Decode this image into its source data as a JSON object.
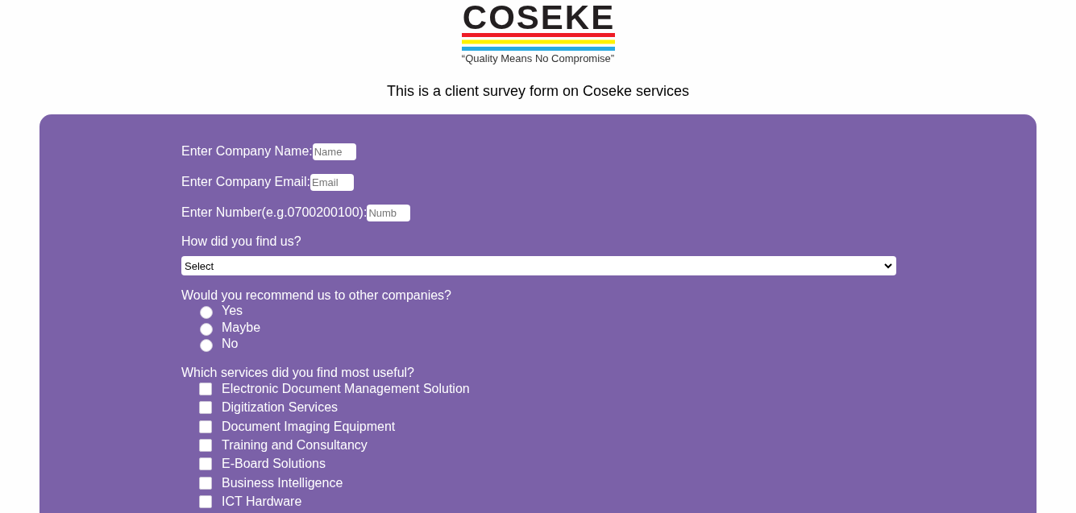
{
  "logo": {
    "wordmark": "COSEKE",
    "tagline": "“Quality Means No Compromise”"
  },
  "intro": "This is a client survey form on Coseke services",
  "fields": [
    {
      "label": "Enter Company Name:",
      "placeholder": "Name"
    },
    {
      "label": "Enter Company Email:",
      "placeholder": "Email"
    },
    {
      "label": "Enter Number(e.g.0700200100):",
      "placeholder": "Numb"
    }
  ],
  "source_question": {
    "label": "How did you find us?",
    "value": "Select"
  },
  "recommend": {
    "question": "Would you recommend us to other companies?",
    "options": [
      {
        "label": "Yes",
        "selected": false
      },
      {
        "label": "Maybe",
        "selected": false
      },
      {
        "label": "No",
        "selected": false
      }
    ]
  },
  "services": {
    "question": "Which services did you find most useful?",
    "options": [
      {
        "label": "Electronic Document Management Solution",
        "checked": false
      },
      {
        "label": "Digitization Services",
        "checked": false
      },
      {
        "label": "Document Imaging Equipment",
        "checked": false
      },
      {
        "label": "Training and Consultancy",
        "checked": false
      },
      {
        "label": "E-Board Solutions",
        "checked": false
      },
      {
        "label": "Business Intelligence",
        "checked": false
      },
      {
        "label": "ICT Hardware",
        "checked": false
      }
    ]
  }
}
